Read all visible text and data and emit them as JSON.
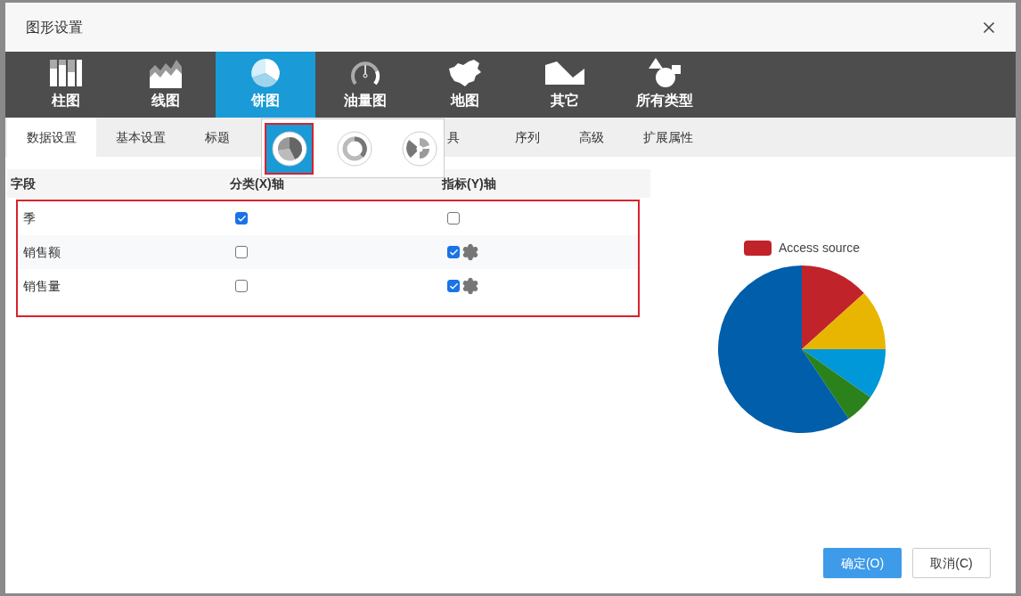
{
  "dialog": {
    "title": "图形设置"
  },
  "chart_types": [
    {
      "label": "柱图",
      "kind": "bar",
      "selected": false
    },
    {
      "label": "线图",
      "kind": "line",
      "selected": false
    },
    {
      "label": "饼图",
      "kind": "pie",
      "selected": true
    },
    {
      "label": "油量图",
      "kind": "gauge",
      "selected": false
    },
    {
      "label": "地图",
      "kind": "map",
      "selected": false
    },
    {
      "label": "其它",
      "kind": "other",
      "selected": false
    },
    {
      "label": "所有类型",
      "kind": "all",
      "selected": false
    }
  ],
  "pie_variants": [
    {
      "kind": "pie",
      "selected": true
    },
    {
      "kind": "ring",
      "selected": false
    },
    {
      "kind": "rose",
      "selected": false
    }
  ],
  "tabs": [
    {
      "label": "数据设置",
      "selected": true
    },
    {
      "label": "基本设置",
      "selected": false
    },
    {
      "label": "标题",
      "selected": false
    },
    {
      "label": "具",
      "selected": false,
      "kind": "partial"
    },
    {
      "label": "序列",
      "selected": false
    },
    {
      "label": "高级",
      "selected": false
    },
    {
      "label": "扩展属性",
      "selected": false
    }
  ],
  "table": {
    "columns": [
      "字段",
      "分类(X)轴",
      "指标(Y)轴"
    ],
    "highlighted": true,
    "rows": [
      {
        "field": "季",
        "x_axis": true,
        "y_axis": false,
        "settings": false
      },
      {
        "field": "销售额",
        "x_axis": false,
        "y_axis": true,
        "settings": true
      },
      {
        "field": "销售量",
        "x_axis": false,
        "y_axis": true,
        "settings": true
      }
    ]
  },
  "preview": {
    "legend": {
      "label": "Access source",
      "color": "#c1232b"
    }
  },
  "buttons": [
    {
      "label": "确定(O)",
      "kind": "primary"
    },
    {
      "label": "取消(C)",
      "kind": "secondary"
    }
  ]
}
